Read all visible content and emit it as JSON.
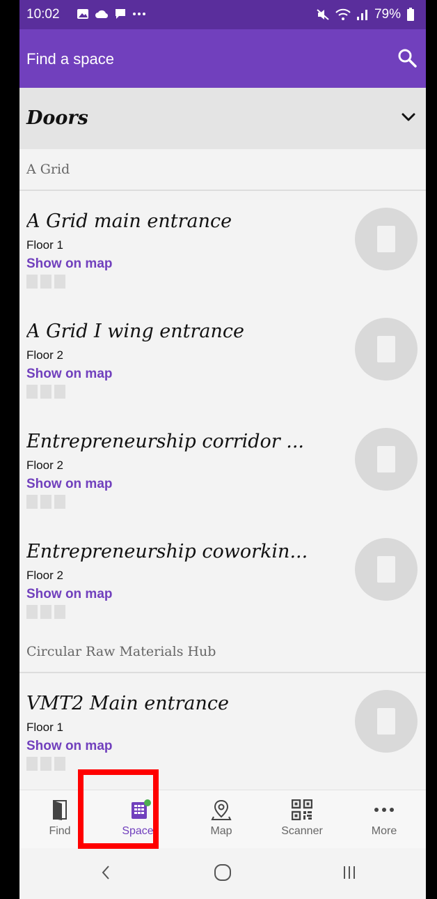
{
  "status": {
    "time": "10:02",
    "battery": "79%"
  },
  "appbar": {
    "title": "Find a space"
  },
  "section": {
    "title": "Doors"
  },
  "groups": [
    {
      "name": "A Grid"
    },
    {
      "name": "Circular Raw Materials Hub"
    }
  ],
  "items": [
    {
      "name": "A Grid main entrance",
      "floor": "Floor 1",
      "link": "Show on map"
    },
    {
      "name": "A Grid I wing entrance",
      "floor": "Floor 2",
      "link": "Show on map"
    },
    {
      "name": "Entrepreneurship corridor ...",
      "floor": "Floor 2",
      "link": "Show on map"
    },
    {
      "name": "Entrepreneurship coworkin...",
      "floor": "Floor 2",
      "link": "Show on map"
    },
    {
      "name": "VMT2 Main entrance",
      "floor": "Floor 1",
      "link": "Show on map"
    }
  ],
  "nav": {
    "find": "Find",
    "spaces": "Spaces",
    "map": "Map",
    "scanner": "Scanner",
    "more": "More",
    "active": "spaces"
  },
  "colors": {
    "accent": "#7140bd",
    "status_bar": "#5a2e9c",
    "highlight": "#ff0000",
    "badge": "#4caf50"
  },
  "icons": [
    "gallery-icon",
    "cloud-icon",
    "chat-icon",
    "more-dots-icon",
    "mute-icon",
    "wifi-icon",
    "signal-icon",
    "battery-icon",
    "search-icon",
    "chevron-down-icon",
    "door-icon",
    "building-icon",
    "map-pin-icon",
    "qr-code-icon",
    "back-icon",
    "home-icon",
    "recents-icon"
  ]
}
